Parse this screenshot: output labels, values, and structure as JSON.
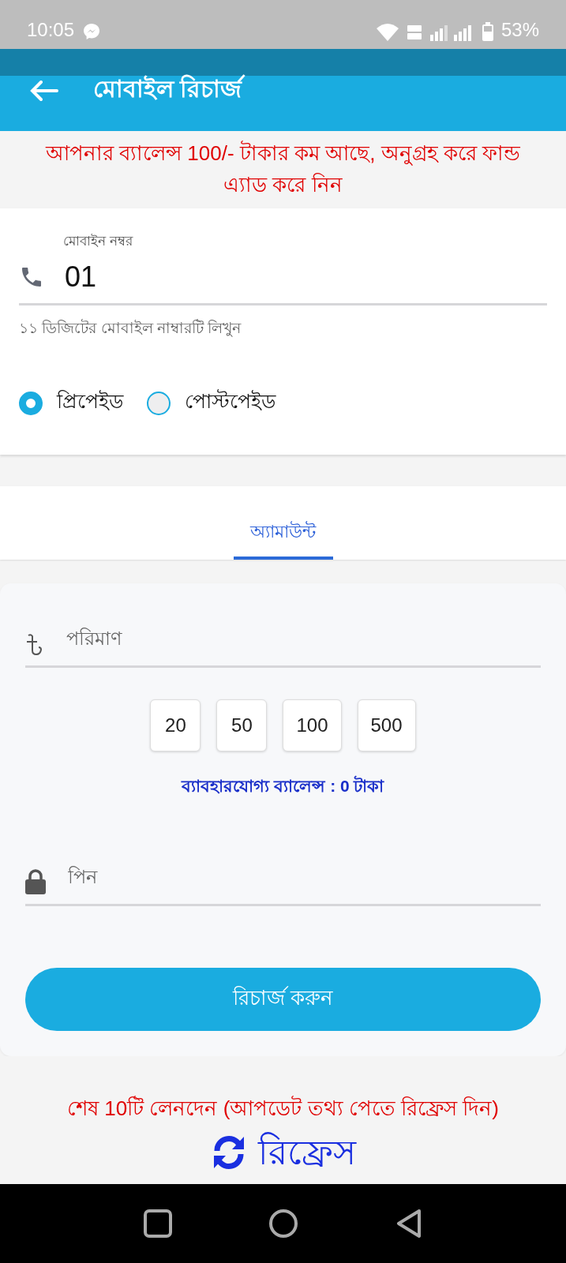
{
  "status_bar": {
    "time": "10:05",
    "battery": "53%"
  },
  "app_bar": {
    "title": "মোবাইল রিচার্জ"
  },
  "warning": "আপনার ব্যালেন্স 100/- টাকার কম আছে, অনুগ্রহ করে ফান্ড এ্যাড করে নিন",
  "mobile_field": {
    "label": "মোবাইন নম্বর",
    "value": "01",
    "helper": "১১ ডিজিটের মোবাইল নাম্বারটি লিখুন"
  },
  "plan_options": [
    {
      "label": "প্রিপেইড",
      "selected": true
    },
    {
      "label": "পোস্টপেইড",
      "selected": false
    }
  ],
  "tabs": [
    {
      "label": "অ্যামাউন্ট",
      "selected": true
    }
  ],
  "amount_field": {
    "placeholder": "পরিমাণ"
  },
  "quick_amounts": [
    "20",
    "50",
    "100",
    "500"
  ],
  "balance_text": "ব্যাবহারযোগ্য ব্যালেন্স : 0 টাকা",
  "pin_field": {
    "placeholder": "পিন"
  },
  "recharge_button": "রিচার্জ করুন",
  "transactions_note": "শেষ 10টি লেনদেন (আপডেট তথ্য পেতে রিফ্রেস দিন)",
  "refresh_link": "রিফ্রেস"
}
